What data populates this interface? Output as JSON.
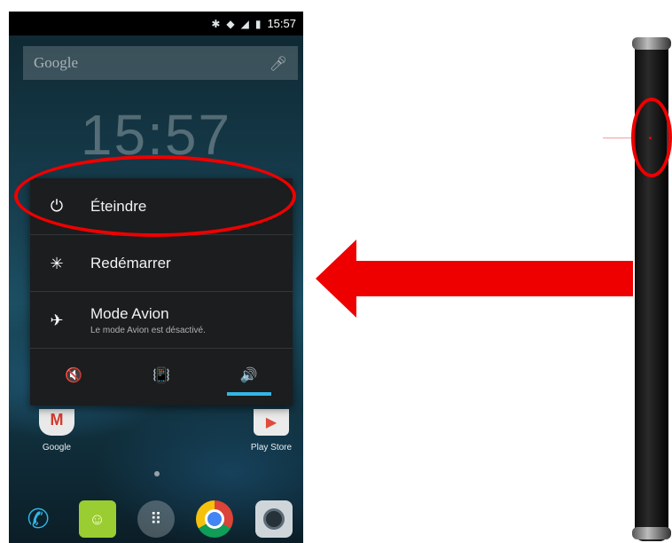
{
  "statusbar": {
    "bluetooth_icon": "bluetooth-icon",
    "wifi_icon": "wifi-icon",
    "signal_icon": "signal-icon",
    "battery_icon": "battery-icon",
    "time": "15:57"
  },
  "search": {
    "placeholder": "Google",
    "mic_icon": "microphone-icon"
  },
  "clock": {
    "time": "15:57"
  },
  "power_menu": {
    "items": [
      {
        "icon": "power-icon",
        "label": "Éteindre",
        "glyph": "⏻"
      },
      {
        "icon": "reboot-icon",
        "label": "Redémarrer",
        "glyph": "✳"
      },
      {
        "icon": "airplane-icon",
        "label": "Mode Avion",
        "sublabel": "Le mode Avion est désactivé.",
        "glyph": "✈"
      }
    ],
    "sound_modes": [
      {
        "icon": "silent-icon",
        "glyph": "🔇",
        "active": false
      },
      {
        "icon": "vibrate-icon",
        "glyph": "📳",
        "active": false
      },
      {
        "icon": "sound-on-icon",
        "glyph": "🔊",
        "active": true
      }
    ]
  },
  "home": {
    "apps": [
      {
        "label": "Google",
        "icon": "gmail-icon"
      },
      {
        "label": "Play Store",
        "icon": "play-store-icon"
      }
    ],
    "dock": [
      {
        "icon": "phone-icon",
        "glyph": "✆"
      },
      {
        "icon": "messaging-icon",
        "glyph": "☺"
      },
      {
        "icon": "app-drawer-icon",
        "glyph": "⠿"
      },
      {
        "icon": "chrome-icon",
        "glyph": ""
      },
      {
        "icon": "camera-icon",
        "glyph": ""
      }
    ]
  },
  "annotation": {
    "arrow_color": "#ee0000",
    "highlight_color": "#ee0000",
    "accent_color": "#33b5e5"
  }
}
